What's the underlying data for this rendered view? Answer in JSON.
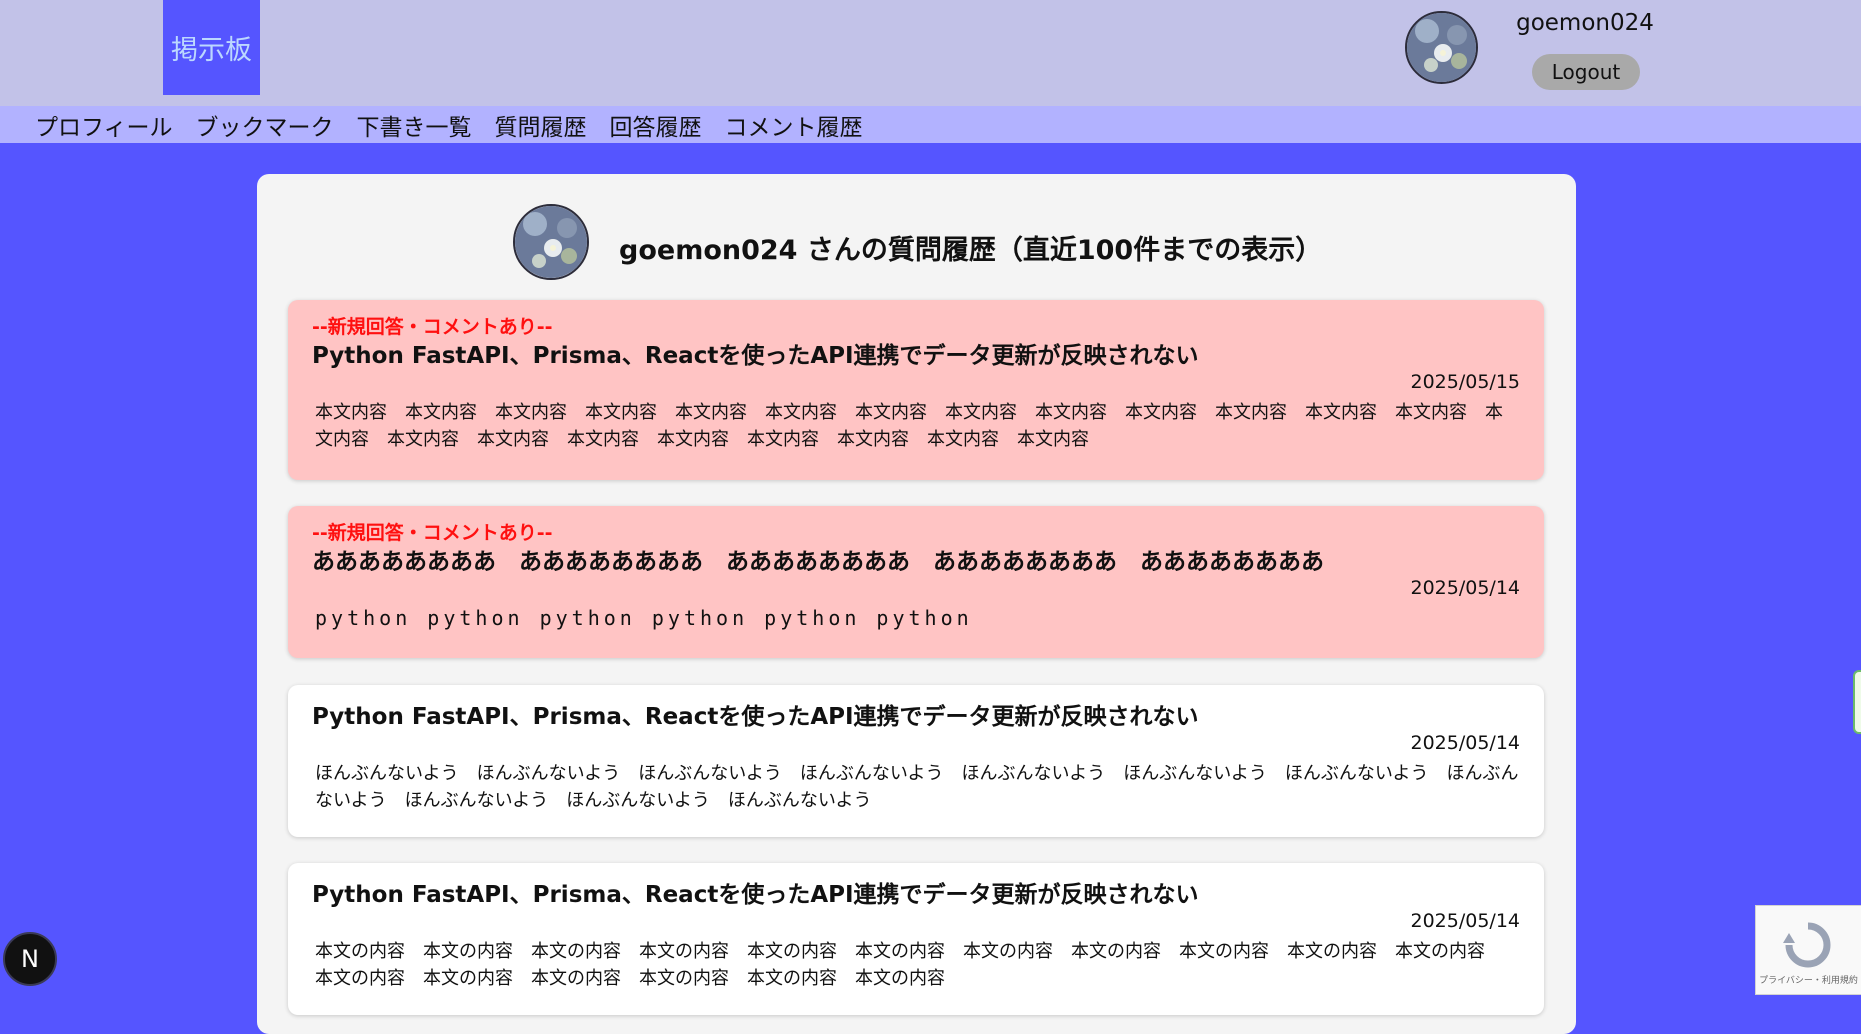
{
  "header": {
    "logo_text": "掲示板",
    "username": "goemon024",
    "logout_label": "Logout"
  },
  "nav": {
    "items": [
      "プロフィール",
      "ブックマーク",
      "下書き一覧",
      "質問履歴",
      "回答履歴",
      "コメント履歴"
    ]
  },
  "page": {
    "title": "goemon024 さんの質問履歴（直近100件までの表示）"
  },
  "questions": [
    {
      "badge": "--新規回答・コメントあり--",
      "title": "Python FastAPI、Prisma、Reactを使ったAPI連携でデータ更新が反映されない",
      "date": "2025/05/15",
      "body": "本文内容　本文内容　本文内容　本文内容　本文内容　本文内容　本文内容　本文内容　本文内容　本文内容　本文内容　本文内容　本文内容　本文内容　本文内容　本文内容　本文内容　本文内容　本文内容　本文内容　本文内容　本文内容"
    },
    {
      "badge": "--新規回答・コメントあり--",
      "title": "ああああああああ　ああああああああ　ああああああああ　ああああああああ　ああああああああ",
      "date": "2025/05/14",
      "body": "python python python python python python"
    },
    {
      "badge": "",
      "title": "Python FastAPI、Prisma、Reactを使ったAPI連携でデータ更新が反映されない",
      "date": "2025/05/14",
      "body": "ほんぶんないよう　ほんぶんないよう　ほんぶんないよう　ほんぶんないよう　ほんぶんないよう　ほんぶんないよう　ほんぶんないよう　ほんぶんないよう　ほんぶんないよう　ほんぶんないよう　ほんぶんないよう"
    },
    {
      "badge": "",
      "title": "Python FastAPI、Prisma、Reactを使ったAPI連携でデータ更新が反映されない",
      "date": "2025/05/14",
      "body": "本文の内容　本文の内容　本文の内容　本文の内容　本文の内容　本文の内容　本文の内容　本文の内容　本文の内容　本文の内容　本文の内容　本文の内容　本文の内容　本文の内容　本文の内容　本文の内容　本文の内容"
    }
  ],
  "widgets": {
    "nextjs_badge": "N",
    "recaptcha_text": "プライバシー・利用規約"
  },
  "colors": {
    "page_bg": "#5555ff",
    "header_bg": "#c2c2e8",
    "nav_bg": "#b2b2ff",
    "new_card_bg": "#ffc4c4",
    "badge_red": "#ff1010"
  }
}
